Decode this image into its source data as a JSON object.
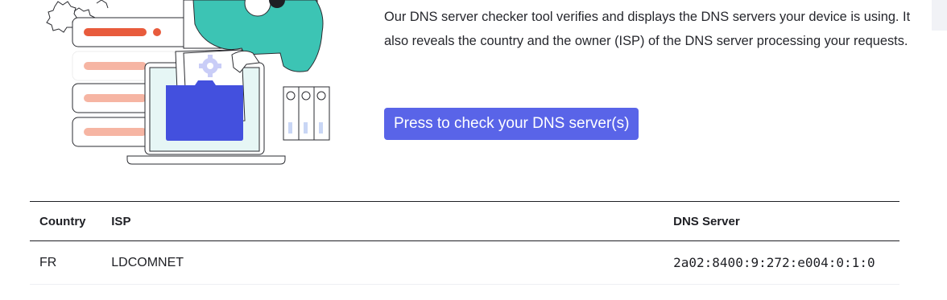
{
  "description": "Our DNS server checker tool verifies and displays the DNS servers your device is using. It also reveals the country and the owner (ISP) of the DNS server processing your requests.",
  "check_button": {
    "label": "Press to check your DNS server(s)"
  },
  "results": {
    "headers": {
      "country": "Country",
      "isp": "ISP",
      "dns_server": "DNS Server"
    },
    "rows": [
      {
        "country": "FR",
        "isp": "LDCOMNET",
        "dns_server": "2a02:8400:9:272:e004:0:1:0"
      }
    ]
  },
  "colors": {
    "button_bg": "#5964e8",
    "button_text": "#ffffff",
    "illustration_teal": "#3cc4b4",
    "illustration_blue": "#4350de",
    "illustration_red": "#e85b3c",
    "illustration_salmon": "#f6b5a3"
  },
  "icons": [
    "server-rack-illustration",
    "person-with-laptop-illustration",
    "folder-icon",
    "gear-icon",
    "binder-files-illustration"
  ]
}
